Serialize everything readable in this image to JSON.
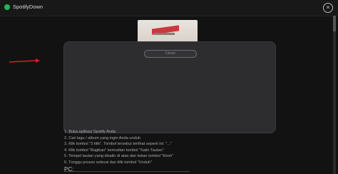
{
  "app": {
    "title": "SpotifyDown"
  },
  "modal": {
    "button_label": "Close"
  },
  "steps": [
    "1. Buka aplikasi Spotify Anda",
    "2. Cari lagu / album yang ingin Anda unduh",
    "3. Klik tombol \"3 titik\". Tombol tersebut terlihat seperti ini: \"...\"",
    "4. Klik tombol \"Bagikan\" kemudian tombol \"Salin Tautan\"",
    "5. Tempel tautan yang disalin di atas dan tekan tombol \"Kirim\"",
    "6. Tunggu proses selesai dan klik tombol \"Unduh\""
  ],
  "section": {
    "pc_label": "PC:"
  },
  "colors": {
    "brand": "#1db954",
    "arrow": "#d81f26",
    "modal": "#2d2d30"
  },
  "icons": {
    "logo": "spotify-logo-icon",
    "close": "close-icon",
    "arrow": "red-arrow-icon"
  }
}
